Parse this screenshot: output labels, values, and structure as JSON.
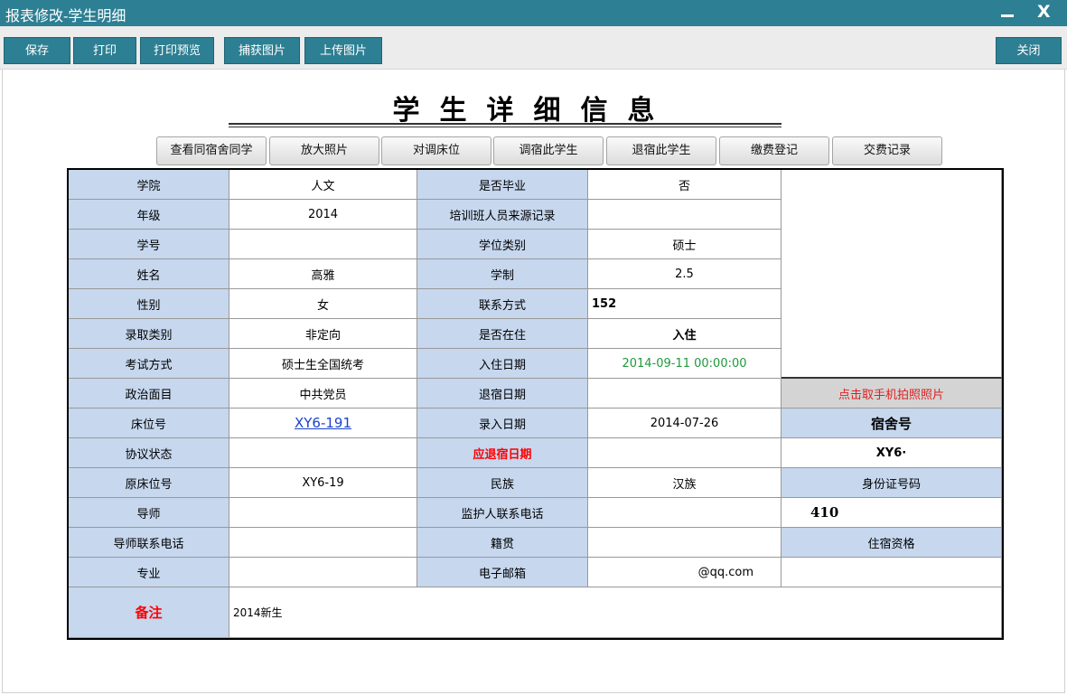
{
  "window": {
    "title": "报表修改-学生明细",
    "min_symbol": "",
    "close_symbol": "X"
  },
  "toolbar": {
    "save": "保存",
    "print": "打印",
    "print_preview": "打印预览",
    "capture": "捕获图片",
    "upload": "上传图片",
    "close": "关闭"
  },
  "page_title": "学生详细信息",
  "actions": [
    "查看同宿舍同学",
    "放大照片",
    "对调床位",
    "调宿此学生",
    "退宿此学生",
    "缴费登记",
    "交费记录"
  ],
  "labels": {
    "college": "学院",
    "grade": "年级",
    "student_no": "学号",
    "name": "姓名",
    "gender": "性别",
    "admission_type": "录取类别",
    "exam_method": "考试方式",
    "political": "政治面目",
    "bed_no": "床位号",
    "agreement": "协议状态",
    "orig_bed": "原床位号",
    "tutor": "导师",
    "tutor_phone": "导师联系电话",
    "major": "专业",
    "remark": "备注",
    "graduated": "是否毕业",
    "training_source": "培训班人员来源记录",
    "degree_type": "学位类别",
    "schooling": "学制",
    "contact": "联系方式",
    "living": "是否在住",
    "checkin_date": "入住日期",
    "checkout_date": "退宿日期",
    "entry_date": "录入日期",
    "due_checkout": "应退宿日期",
    "ethnicity": "民族",
    "guardian_phone": "监护人联系电话",
    "native_place": "籍贯",
    "email": "电子邮箱",
    "photo_btn": "点击取手机拍照照片",
    "dorm_no": "宿舍号",
    "id_no": "身份证号码",
    "qualification": "住宿资格"
  },
  "values": {
    "college": "人文",
    "grade": "2014",
    "student_no": "",
    "name": "高雅",
    "gender": "女",
    "admission_type": "非定向",
    "exam_method": "硕士生全国统考",
    "political": "中共党员",
    "bed_no": "XY6-191",
    "agreement": "",
    "orig_bed": "XY6-19",
    "tutor": "",
    "tutor_phone": "",
    "major": "",
    "remark": "2014新生",
    "graduated": "否",
    "training_source": "",
    "degree_type": "硕士",
    "schooling": "2.5",
    "contact": "152",
    "living": "入住",
    "checkin_date": "2014-09-11 00:00:00",
    "checkout_date": "",
    "entry_date": "2014-07-26",
    "due_checkout": "",
    "ethnicity": "汉族",
    "guardian_phone": "",
    "native_place": "",
    "email": "@qq.com",
    "dorm_no": "XY6·",
    "id_no": "410",
    "qualification": ""
  },
  "colors": {
    "titlebar": "#2d7f93",
    "label_bg": "#c6d7ee",
    "red": "#ff0000",
    "green": "#1f9a3c",
    "link": "#1a44c8"
  }
}
